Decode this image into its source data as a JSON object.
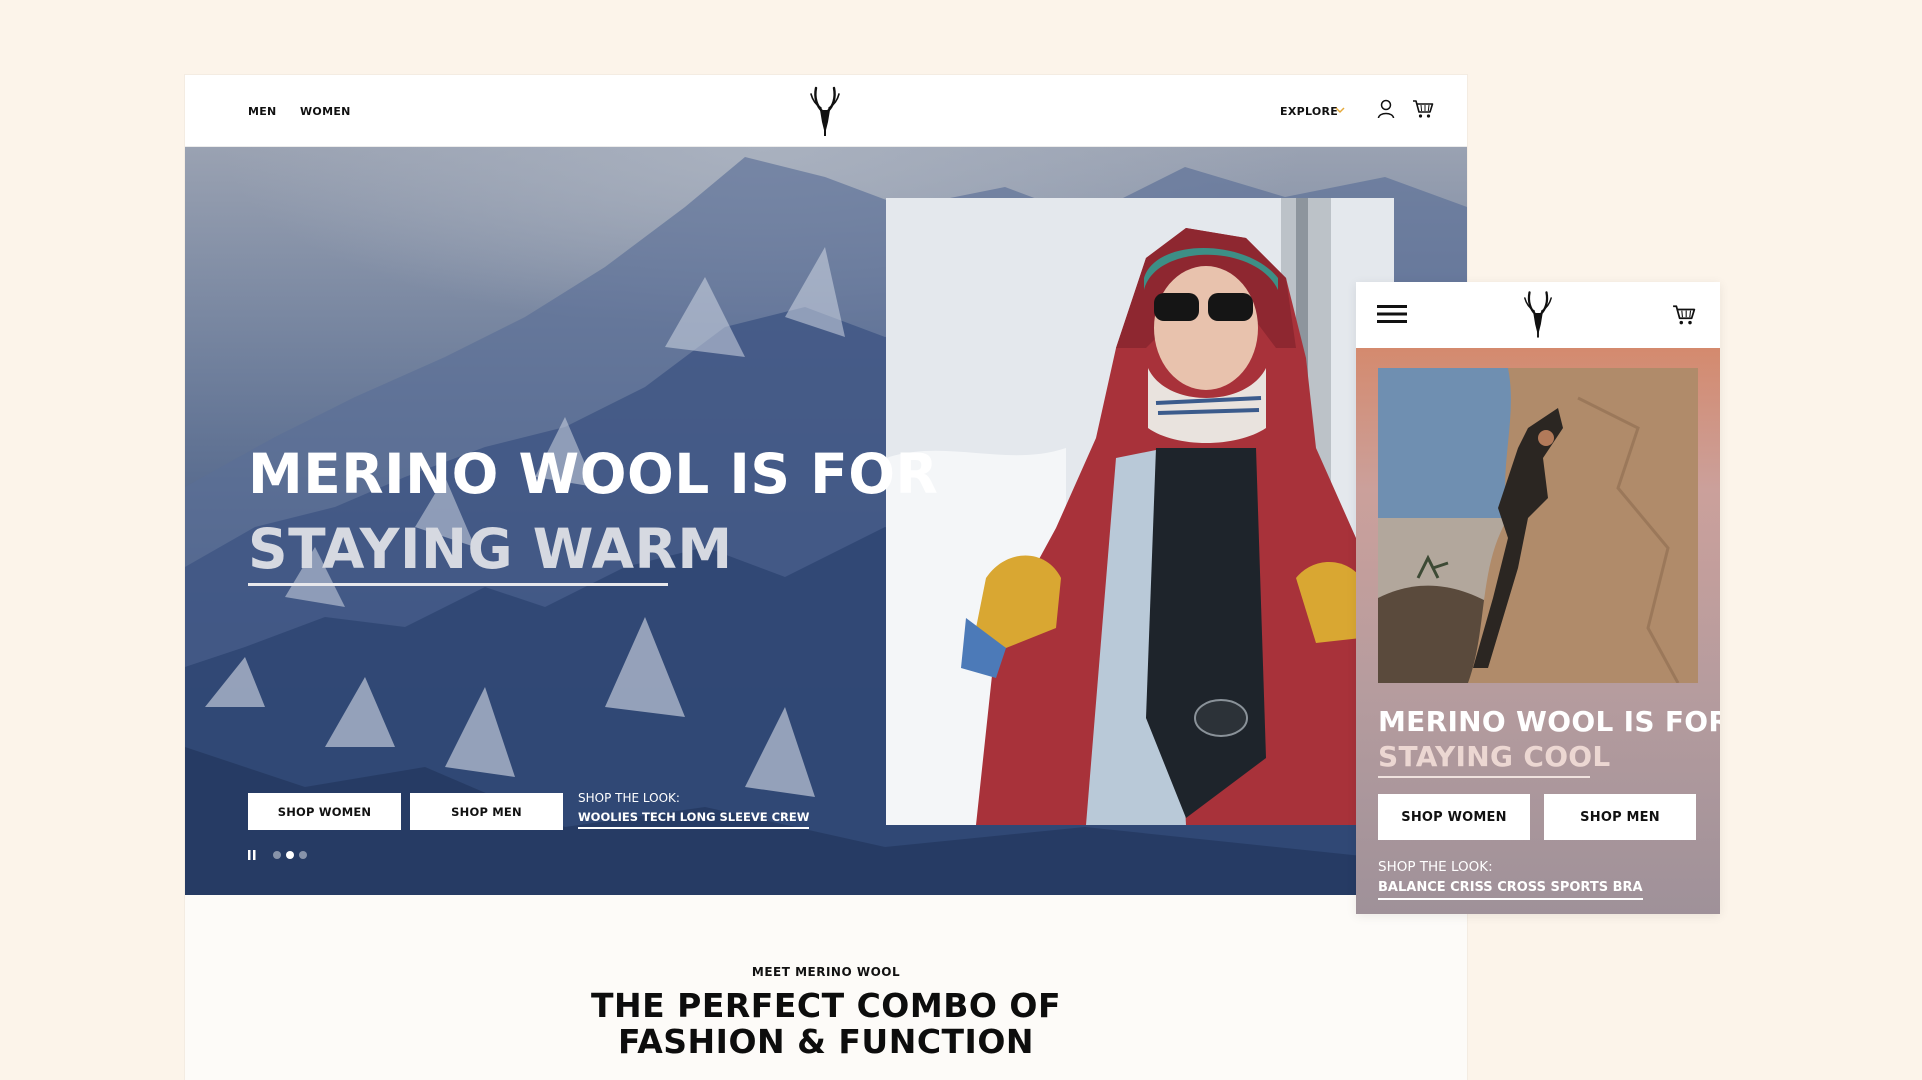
{
  "desktop": {
    "nav": {
      "men": "MEN",
      "women": "WOMEN",
      "explore": "EXPLORE",
      "icons": [
        "ibex-logo-icon",
        "chevron-down-icon",
        "user-icon",
        "cart-icon"
      ]
    },
    "hero": {
      "headline_line1": "MERINO WOOL IS FOR",
      "headline_line2": "STAYING WARM",
      "shop_women": "SHOP WOMEN",
      "shop_men": "SHOP MEN",
      "shop_the_look": "SHOP THE LOOK:",
      "product": "WOOLIES TECH LONG SLEEVE CREW",
      "carousel": {
        "slides": 3,
        "active": 2
      }
    },
    "intro": {
      "eyebrow": "MEET MERINO WOOL",
      "title_line1": "THE PERFECT COMBO OF",
      "title_line2": "FASHION & FUNCTION"
    }
  },
  "mobile": {
    "nav": {
      "icons": [
        "hamburger-menu-icon",
        "ibex-logo-icon",
        "cart-icon"
      ]
    },
    "hero": {
      "headline_line1": "MERINO WOOL IS FOR",
      "headline_line2": "STAYING COOL",
      "shop_women": "SHOP WOMEN",
      "shop_men": "SHOP MEN",
      "shop_the_look": "SHOP THE LOOK:",
      "product": "BALANCE CRISS CROSS SPORTS BRA"
    }
  },
  "colors": {
    "page_background": "#fcf4ea",
    "accent_chevron": "#e5a93a",
    "text_dark": "#111111",
    "button_bg": "#ffffff"
  }
}
